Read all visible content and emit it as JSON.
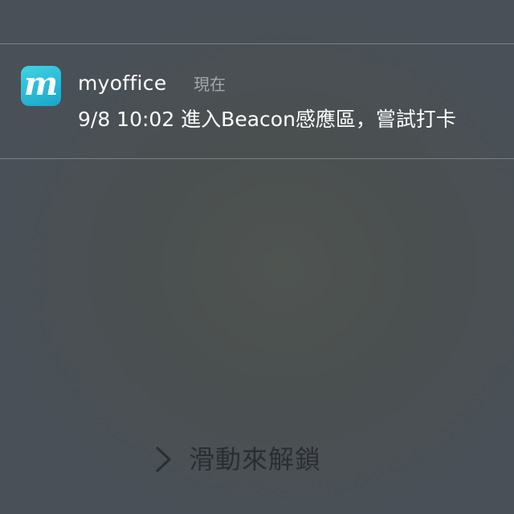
{
  "notification": {
    "app_icon": {
      "name": "myoffice-app-icon",
      "glyph": "m",
      "colors": [
        "#3fd2e4",
        "#1aa7c9"
      ]
    },
    "app_name": "myoffice",
    "time": "現在",
    "message": "9/8 10:02 進入Beacon感應區，嘗試打卡"
  },
  "unlock": {
    "icon": "chevron-right-icon",
    "label": "滑動來解鎖"
  },
  "colors": {
    "background": "#4a5057",
    "divider": "#7c8289",
    "text_primary": "#ffffff",
    "text_secondary": "#a4a8ad",
    "unlock_text": "#2b2e31"
  }
}
